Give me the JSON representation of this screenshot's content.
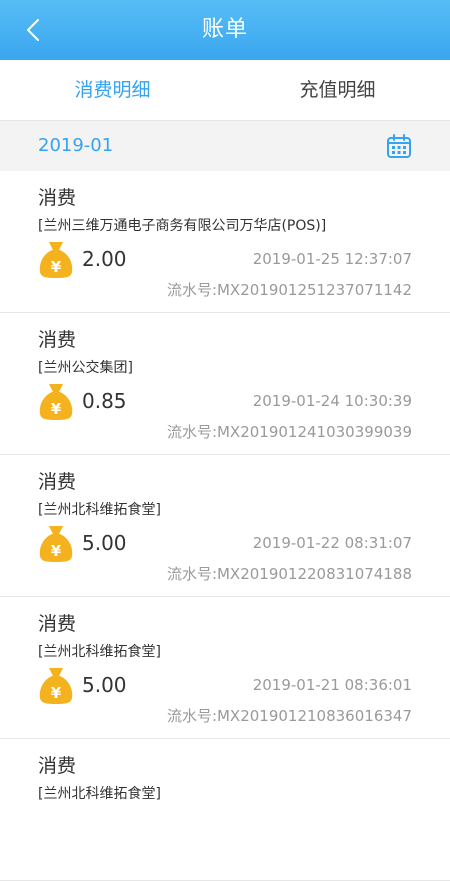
{
  "header": {
    "title": "账单"
  },
  "tabs": [
    {
      "label": "消费明细"
    },
    {
      "label": "充值明细"
    }
  ],
  "date_filter": {
    "value": "2019-01"
  },
  "records": [
    {
      "type": "消费",
      "merchant": "[兰州三维万通电子商务有限公司万华店(POS)]",
      "amount": "2.00",
      "time": "2019-01-25  12:37:07",
      "serial": "流水号:MX201901251237071142"
    },
    {
      "type": "消费",
      "merchant": "[兰州公交集团]",
      "amount": "0.85",
      "time": "2019-01-24  10:30:39",
      "serial": "流水号:MX201901241030399039"
    },
    {
      "type": "消费",
      "merchant": "[兰州北科维拓食堂]",
      "amount": "5.00",
      "time": "2019-01-22  08:31:07",
      "serial": "流水号:MX201901220831074188"
    },
    {
      "type": "消费",
      "merchant": "[兰州北科维拓食堂]",
      "amount": "5.00",
      "time": "2019-01-21  08:36:01",
      "serial": "流水号:MX201901210836016347"
    },
    {
      "type": "消费",
      "merchant": "[兰州北科维拓食堂]",
      "amount": "",
      "time": "",
      "serial": ""
    }
  ],
  "colors": {
    "accent": "#36a3ee",
    "header_start": "#57bdf6",
    "bag": "#f5b21f"
  },
  "icons": {
    "back": "chevron-left-icon",
    "calendar": "calendar-icon",
    "money_bag": "money-bag-icon"
  }
}
